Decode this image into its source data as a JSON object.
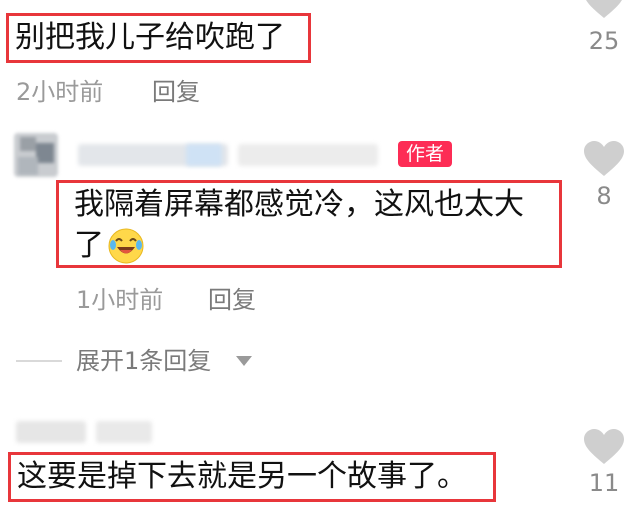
{
  "comments": [
    {
      "text": "别把我儿子给吹跑了",
      "time": "2小时前",
      "reply_label": "回复",
      "likes": "25"
    },
    {
      "badge": "作者",
      "text_line1": "我隔着屏幕都感觉冷，这风也太大",
      "text_line2": "了",
      "emoji": "crying-laughing-emoji",
      "time": "1小时前",
      "reply_label": "回复",
      "likes": "8"
    },
    {
      "text": "这要是掉下去就是另一个故事了。",
      "likes": "11"
    }
  ],
  "expand_replies": {
    "label": "展开1条回复",
    "icon": "triangle-down-icon"
  },
  "colors": {
    "highlight_box": "#e8363b",
    "author_badge": "#fd2c55",
    "heart": "#cfcfcf",
    "meta_text": "#9a9a9a"
  }
}
